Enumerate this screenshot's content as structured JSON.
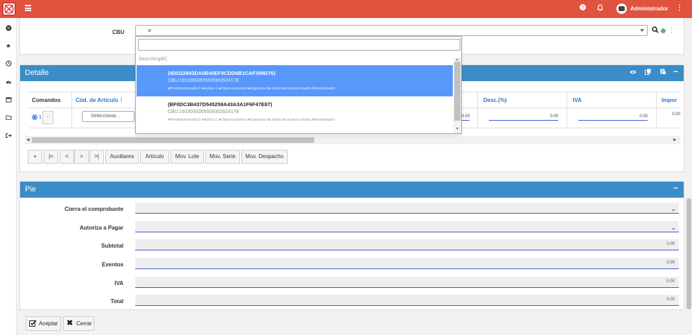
{
  "header": {
    "user_name": "Administrador",
    "help_icon": "question-circle-icon",
    "notification_icon": "bell-icon",
    "menu_icon": "kebab-icon"
  },
  "sidebar": {
    "icons": [
      "globe-icon",
      "star-icon",
      "clock-icon",
      "tachometer-icon",
      "calendar-icon",
      "folder-icon",
      "sign-out-icon"
    ]
  },
  "cbu": {
    "label": "CBU",
    "clear": "×"
  },
  "dropdown": {
    "searching": "Searchingâ€¦",
    "options": [
      {
        "title": "(4DD22843DA0B40EF9CDD6B1CAF399D76)",
        "cbu": "CBU:1910093355009302624178",
        "meta": "●Predeterminado:0 ●Activo:1 ●Observaciones:●Esquema de datos:●Usuario creado:Administrador",
        "active": true
      },
      {
        "title": "(BF0DC3B437D545259A43A3A1F6F47E87)",
        "cbu": "CBU:1910093355009302624178",
        "meta": "●Predeterminado:0 ●Activo:1 ●Observaciones:●Esquema de datos:●Usuario creado:Administrador",
        "active": false
      }
    ]
  },
  "detalle": {
    "title": "Detalle",
    "columns": {
      "comandos": "Comandos",
      "articulo": "Cód. de Artículo",
      "descuento": "Desc.(%)",
      "iva": "IVA",
      "importe": "Impor"
    },
    "row": {
      "number": "1",
      "cmd": "-",
      "select_placeholder": "Seleccionar...",
      "value_left": "0.00",
      "desc": "0.00",
      "iva": "0.00",
      "importe": "0.00"
    },
    "nav_buttons": [
      "+",
      "|<",
      "<",
      ">",
      ">|",
      "Auxiliares",
      "Articulo",
      "Mov. Lote",
      "Mov. Serie",
      "Mov. Despacho"
    ]
  },
  "pie": {
    "title": "Pie",
    "fields": [
      {
        "label": "Cierra el comprobante",
        "value": "",
        "type": "select"
      },
      {
        "label": "Autoriza a Pagar",
        "value": "",
        "type": "select"
      },
      {
        "label": "Subtotal",
        "value": "0.00",
        "type": "number"
      },
      {
        "label": "Exentos",
        "value": "0.00",
        "type": "number"
      },
      {
        "label": "IVA",
        "value": "0.00",
        "type": "number"
      },
      {
        "label": "Total",
        "value": "0.00",
        "type": "number"
      }
    ]
  },
  "actions": {
    "accept": "Aceptar",
    "close": "Cerrar"
  },
  "colors": {
    "topbar": "#e0533f",
    "panel_header": "#3a8dc8",
    "selected_option": "#5897fb",
    "link_blue": "#2a77c8"
  }
}
